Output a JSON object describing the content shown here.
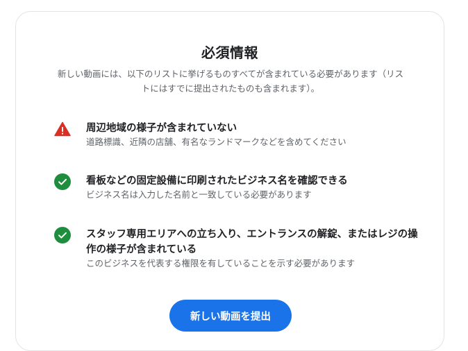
{
  "card": {
    "title": "必須情報",
    "intro": "新しい動画には、以下のリストに挙げるものすべてが含まれている必要があります（リストにはすでに提出されたものも含まれます）。"
  },
  "requirements": [
    {
      "status": "warning",
      "icon": "warning-triangle-icon",
      "title": "周辺地域の様子が含まれていない",
      "description": "道路標識、近隣の店舗、有名なランドマークなどを含めてください"
    },
    {
      "status": "ok",
      "icon": "check-circle-icon",
      "title": "看板などの固定設備に印刷されたビジネス名を確認できる",
      "description": "ビジネス名は入力した名前と一致している必要があります"
    },
    {
      "status": "ok",
      "icon": "check-circle-icon",
      "title": "スタッフ専用エリアへの立ち入り、エントランスの解錠、またはレジの操作の様子が含まれている",
      "description": "このビジネスを代表する権限を有していることを示す必要があります"
    }
  ],
  "actions": {
    "submit_label": "新しい動画を提出"
  },
  "colors": {
    "warning": "#d93025",
    "ok": "#1e8e3e",
    "primary": "#1a73e8"
  }
}
